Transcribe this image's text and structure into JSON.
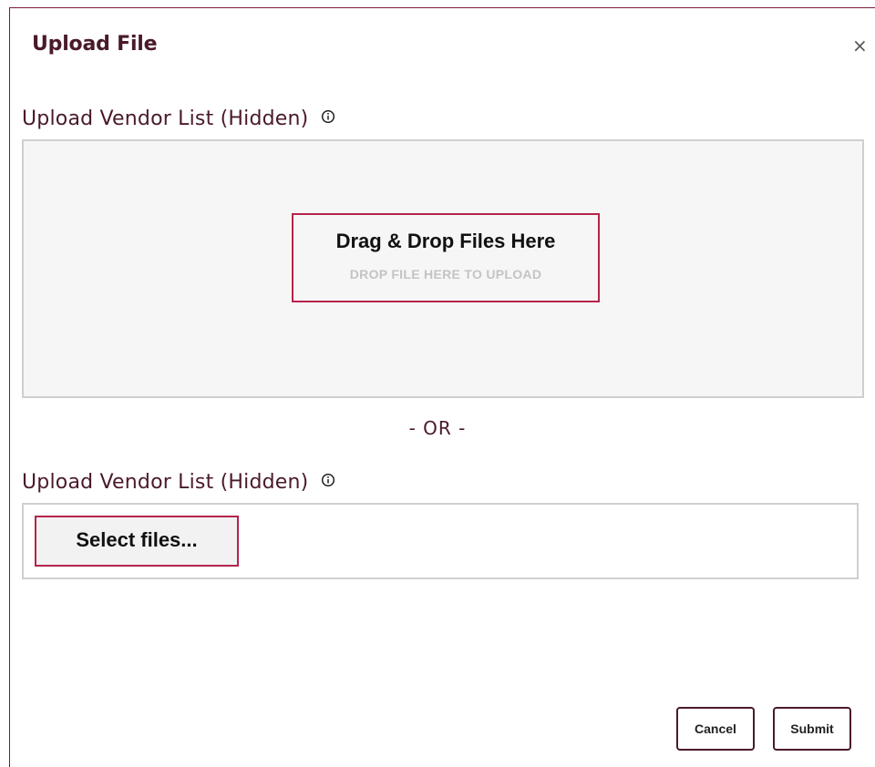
{
  "dialog": {
    "title": "Upload File",
    "close_glyph": "×"
  },
  "upload_section": {
    "label": "Upload Vendor List (Hidden)",
    "info_icon": "info-circle-icon",
    "dropzone": {
      "title": "Drag & Drop Files Here",
      "subtitle": "DROP FILE HERE TO UPLOAD"
    }
  },
  "divider": {
    "text": "- OR -"
  },
  "select_section": {
    "label": "Upload Vendor List (Hidden)",
    "info_icon": "info-circle-icon",
    "select_button_label": "Select files..."
  },
  "footer": {
    "cancel_label": "Cancel",
    "submit_label": "Submit"
  },
  "colors": {
    "brand": "#4a1a2a",
    "accent": "#b5244a",
    "dropzone_bg": "#f6f6f6",
    "border": "#cfcfcf"
  }
}
